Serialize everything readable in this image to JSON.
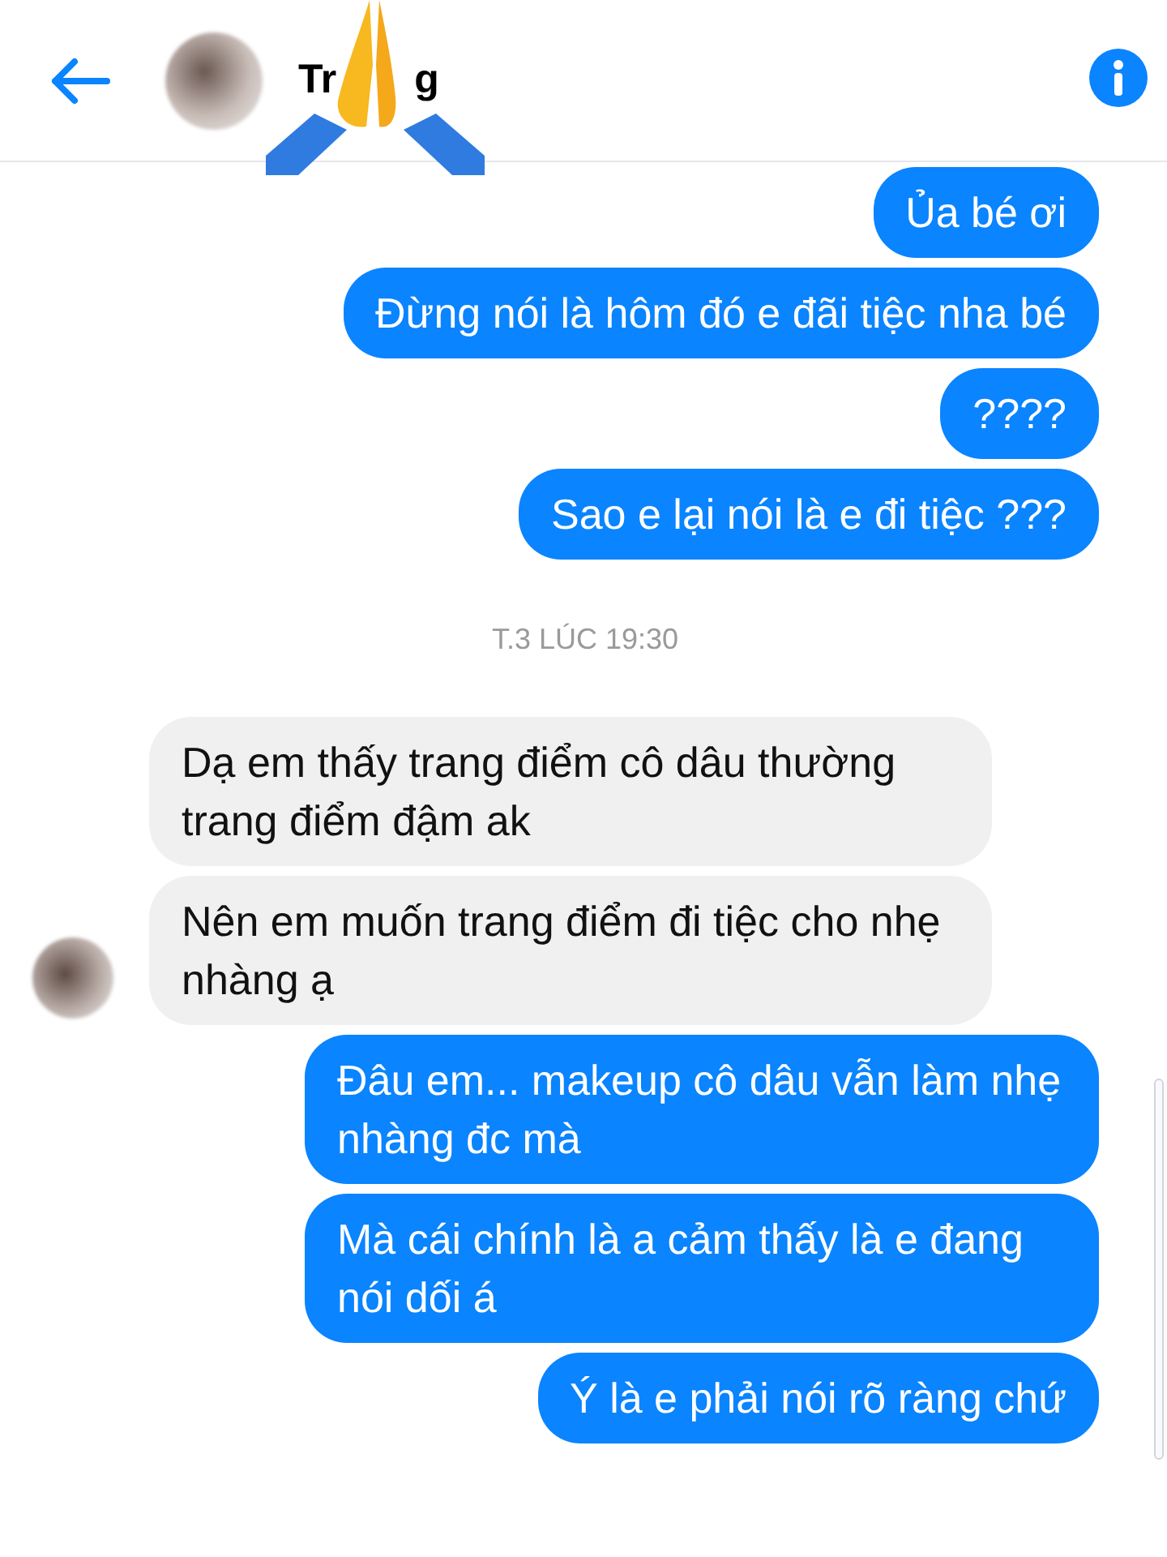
{
  "header": {
    "contact_name_visible": [
      "Tr",
      "g"
    ]
  },
  "messages": [
    {
      "kind": "out",
      "text": "Ủa bé ơi"
    },
    {
      "kind": "out",
      "text": "Đừng nói là hôm đó e đãi tiệc nha bé"
    },
    {
      "kind": "out",
      "text": "????"
    },
    {
      "kind": "out",
      "text": "Sao e lại nói là e đi tiệc ???"
    },
    {
      "kind": "time",
      "text": "T.3 LÚC 19:30"
    },
    {
      "kind": "in",
      "text": "Dạ em thấy trang điểm cô dâu thường trang điểm đậm ak"
    },
    {
      "kind": "in",
      "text": "Nên em muốn trang điểm đi tiệc cho nhẹ nhàng ạ"
    },
    {
      "kind": "out",
      "text": "Đâu em... makeup cô dâu vẫn làm nhẹ nhàng đc mà"
    },
    {
      "kind": "out",
      "text": "Mà cái chính là a cảm thấy là e đang nói dối á"
    },
    {
      "kind": "out",
      "text": "Ý là e phải nói rõ ràng chứ"
    }
  ]
}
